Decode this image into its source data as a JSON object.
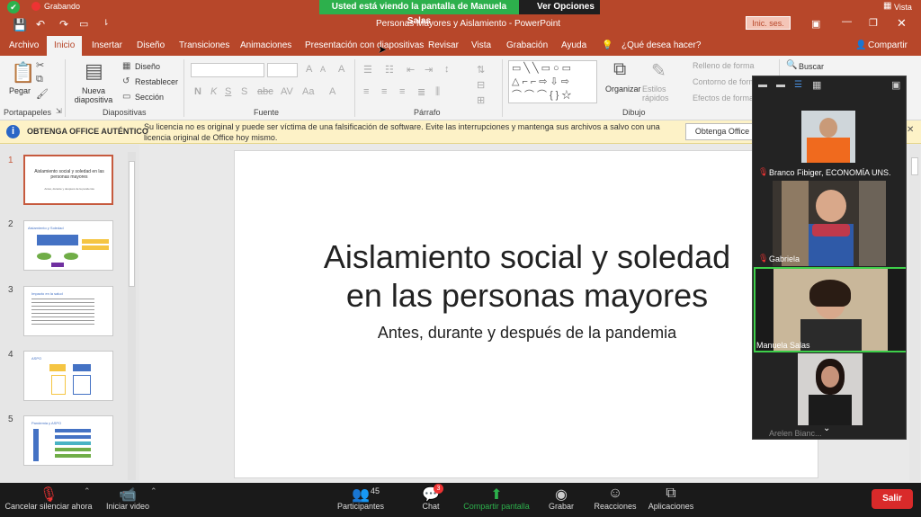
{
  "recording": {
    "label": "Grabando"
  },
  "zoom": {
    "banner": "Usted está viendo la pantalla de Manuela Salas",
    "view_options": "Ver Opciones",
    "view": "Vista"
  },
  "window": {
    "title": "Personas Mayores y Aislamiento  -  PowerPoint",
    "signin": "Inic. ses."
  },
  "tabs": [
    "Archivo",
    "Inicio",
    "Insertar",
    "Diseño",
    "Transiciones",
    "Animaciones",
    "Presentación con diapositivas",
    "Revisar",
    "Vista",
    "Grabación",
    "Ayuda"
  ],
  "tell_me": "¿Qué desea hacer?",
  "share": "Compartir",
  "ribbon": {
    "paste": "Pegar",
    "new_slide": "Nueva diapositiva",
    "design": "Diseño",
    "reset": "Restablecer",
    "section": "Sección",
    "arrange": "Organizar",
    "quick_styles": "Estilos rápidos",
    "fill": "Relleno de forma",
    "outline": "Contorno de forma",
    "effects": "Efectos de forma",
    "find": "Buscar",
    "groups": {
      "clipboard": "Portapapeles",
      "slides": "Diapositivas",
      "font": "Fuente",
      "paragraph": "Párrafo",
      "drawing": "Dibujo"
    }
  },
  "license": {
    "title": "OBTENGA OFFICE AUTÉNTICO",
    "message": "Su licencia no es original y puede ser víctima de una falsificación de software. Evite las interrupciones y mantenga sus archivos a salvo con una licencia original de Office hoy mismo.",
    "button": "Obtenga Office"
  },
  "thumbnails": [
    {
      "num": "1",
      "title": "Aislamiento social y soledad en las personas mayores",
      "subtitle": "Antes, durante y después de la pandemia"
    },
    {
      "num": "2",
      "title": "Aislamiento y Soledad"
    },
    {
      "num": "3",
      "title": "Impacto en la salud"
    },
    {
      "num": "4",
      "title": "ASPO"
    },
    {
      "num": "5",
      "title": "Pandemia y ASPO"
    }
  ],
  "slide": {
    "title_line1": "Aislamiento social y soledad",
    "title_line2": "en las personas mayores",
    "subtitle": "Antes, durante y después de la pandemia"
  },
  "participants": [
    {
      "name": "Branco Fibiger, ECONOMÍA UNS."
    },
    {
      "name": "Gabriela"
    },
    {
      "name": "Manuela Salas"
    },
    {
      "name": "Arelen Bianc..."
    }
  ],
  "bottom_bar": {
    "unmute": "Cancelar silenciar ahora",
    "video": "Iniciar video",
    "participants": "Participantes",
    "participants_count": "45",
    "chat": "Chat",
    "chat_badge": "3",
    "share_screen": "Compartir pantalla",
    "record": "Grabar",
    "reactions": "Reacciones",
    "apps": "Aplicaciones",
    "leave": "Salir"
  },
  "colors": {
    "accent": "#b7472a",
    "zoom_green": "#2db04c",
    "leave_red": "#d92a2a"
  }
}
